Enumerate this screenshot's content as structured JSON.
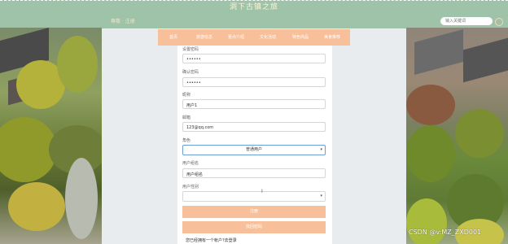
{
  "header": {
    "site_title": "洞下古镇之旅",
    "greeting": "尊敬 · 注册",
    "search_placeholder": "输入关键词"
  },
  "nav": {
    "items": [
      "首页",
      "旅游信息",
      "景点介绍",
      "文化活动",
      "特色商品",
      "美食推荐"
    ]
  },
  "form": {
    "fields": [
      {
        "label": "设置密码",
        "value": "••••••"
      },
      {
        "label": "确认密码",
        "value": "••••••"
      },
      {
        "label": "昵称",
        "value": "用户1"
      },
      {
        "label": "邮箱",
        "value": "123@qq.com"
      }
    ],
    "role": {
      "label": "角色",
      "value": "普通用户"
    },
    "group": {
      "label": "用户组名",
      "value": "用户组名"
    },
    "level": {
      "label": "用户性别",
      "value": ""
    },
    "register_button": "注册",
    "reset_button": "找回密码",
    "login_prompt": "您已经拥有一个帐户?去登录"
  },
  "watermark": "CSDN @v:MZ_ZXD001"
}
